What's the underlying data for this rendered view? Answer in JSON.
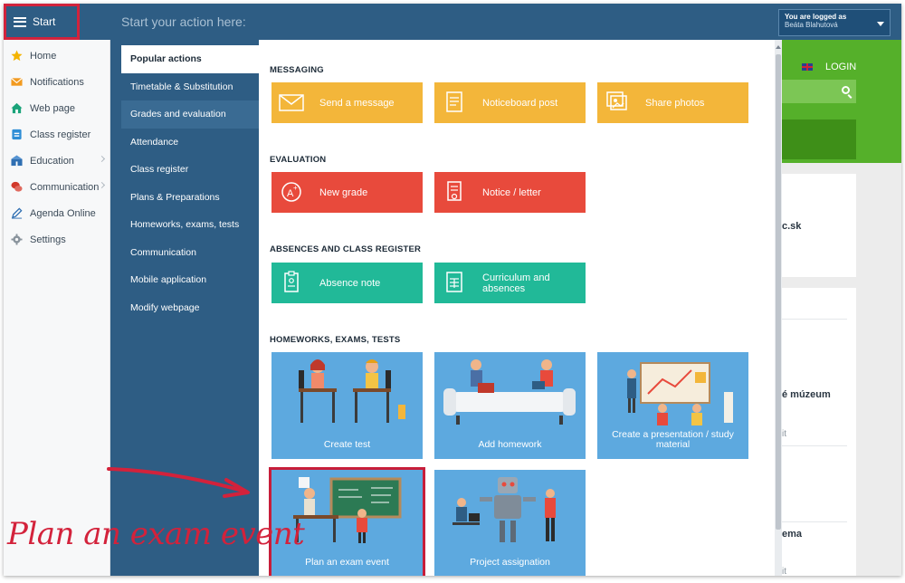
{
  "topbar": {
    "start_label": "Start",
    "action_placeholder": "Start your action here:",
    "user_line1": "You are logged as",
    "user_line2": "Beáta Blahutová"
  },
  "sidebar": {
    "items": [
      {
        "label": "Home",
        "icon": "star-icon",
        "color": "#f4b400"
      },
      {
        "label": "Notifications",
        "icon": "envelope-icon",
        "color": "#f29a1f"
      },
      {
        "label": "Web page",
        "icon": "house-icon",
        "color": "#1aa37a"
      },
      {
        "label": "Class register",
        "icon": "register-icon",
        "color": "#2f8ed6"
      },
      {
        "label": "Education",
        "icon": "education-icon",
        "color": "#2f6fb2"
      },
      {
        "label": "Communication",
        "icon": "chat-icon",
        "color": "#d1392b"
      },
      {
        "label": "Agenda Online",
        "icon": "pen-icon",
        "color": "#2f6fb2"
      },
      {
        "label": "Settings",
        "icon": "gear-icon",
        "color": "#8a949d"
      }
    ]
  },
  "menu": {
    "items": [
      "Popular actions",
      "Timetable & Substitution",
      "Grades and evaluation",
      "Attendance",
      "Class register",
      "Plans & Preparations",
      "Homeworks, exams, tests",
      "Communication",
      "Mobile application",
      "Modify webpage"
    ]
  },
  "sections": {
    "messaging": {
      "title": "MESSAGING",
      "tiles": [
        "Send a message",
        "Noticeboard post",
        "Share photos"
      ]
    },
    "evaluation": {
      "title": "EVALUATION",
      "tiles": [
        "New grade",
        "Notice / letter"
      ]
    },
    "absences": {
      "title": "ABSENCES AND CLASS REGISTER",
      "tiles": [
        "Absence note",
        "Curriculum and absences"
      ]
    },
    "homeworks": {
      "title": "HOMEWORKS, EXAMS, TESTS",
      "tiles": [
        "Create test",
        "Add homework",
        "Create a presentation / study material",
        "Plan an exam event",
        "Project assignation"
      ]
    }
  },
  "background_page": {
    "login": "LOGIN",
    "frag1": "c.sk",
    "frag2": "é múzeum",
    "frag3": "it",
    "frag4": "ema",
    "frag5": "it"
  },
  "annotation": "Plan an exam event",
  "colors": {
    "topbar": "#2e5d84",
    "yellow_tile": "#f3b63a",
    "red_tile": "#e84a3c",
    "green_tile": "#21b998",
    "blue_tile": "#5da9df",
    "highlight": "#c71e3a"
  }
}
